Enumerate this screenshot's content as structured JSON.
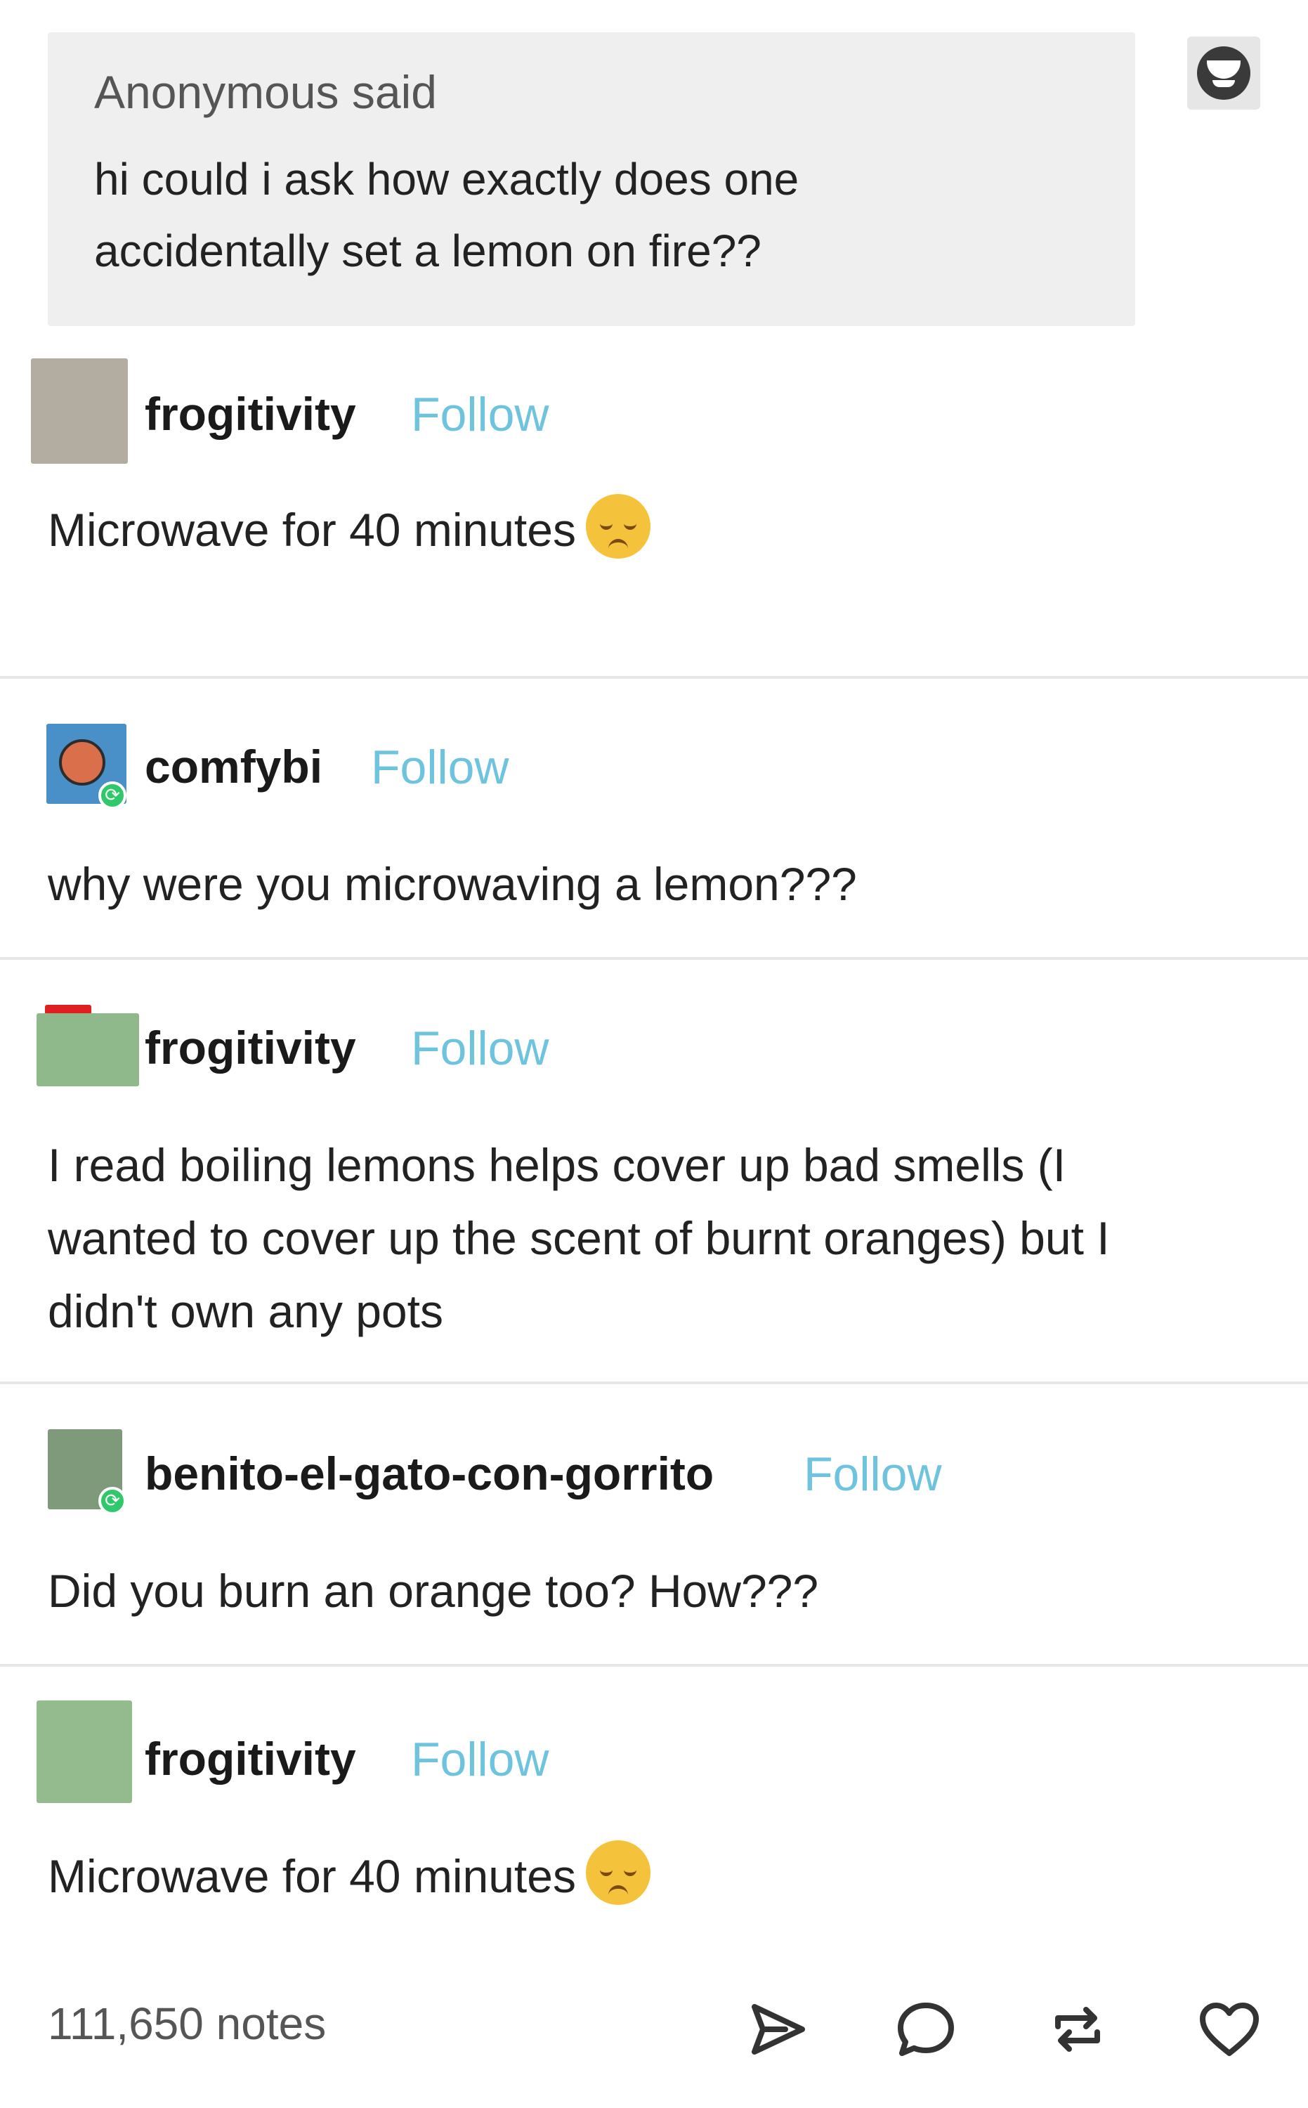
{
  "ask": {
    "author": "Anonymous",
    "said": "said",
    "lines": [
      "hi could i ask how exactly does one",
      "accidentally set a lemon on fire??"
    ]
  },
  "replies": [
    {
      "username": "frogitivity",
      "follow": "Follow",
      "lines": [
        "Microwave for 40 minutes"
      ],
      "emoji": "pensive-face-icon",
      "avatar_color": "#b3aca0"
    },
    {
      "username": "comfybi",
      "follow": "Follow",
      "lines": [
        "why were you microwaving a lemon???"
      ],
      "avatar_color": "#4a90c8"
    },
    {
      "username": "frogitivity",
      "follow": "Follow",
      "lines": [
        "I read boiling lemons helps cover up bad smells (I",
        "wanted to cover up the scent of burnt oranges) but I",
        "didn't own any pots"
      ],
      "avatar_color": "#8fb98a"
    },
    {
      "username": "benito-el-gato-con-gorrito",
      "follow": "Follow",
      "lines": [
        "Did you burn an orange too? How???"
      ],
      "avatar_color": "#7f9a7a"
    },
    {
      "username": "frogitivity",
      "follow": "Follow",
      "lines": [
        "Microwave for 40 minutes"
      ],
      "emoji": "pensive-face-icon",
      "avatar_color": "#93bb8e"
    }
  ],
  "footer": {
    "notes": "111,650 notes",
    "actions": [
      "share-icon",
      "reply-icon",
      "reblog-icon",
      "like-icon"
    ]
  },
  "colors": {
    "follow": "#6ec3df",
    "ask_background": "#efefef",
    "reblog_badge": "#2fc86a"
  }
}
